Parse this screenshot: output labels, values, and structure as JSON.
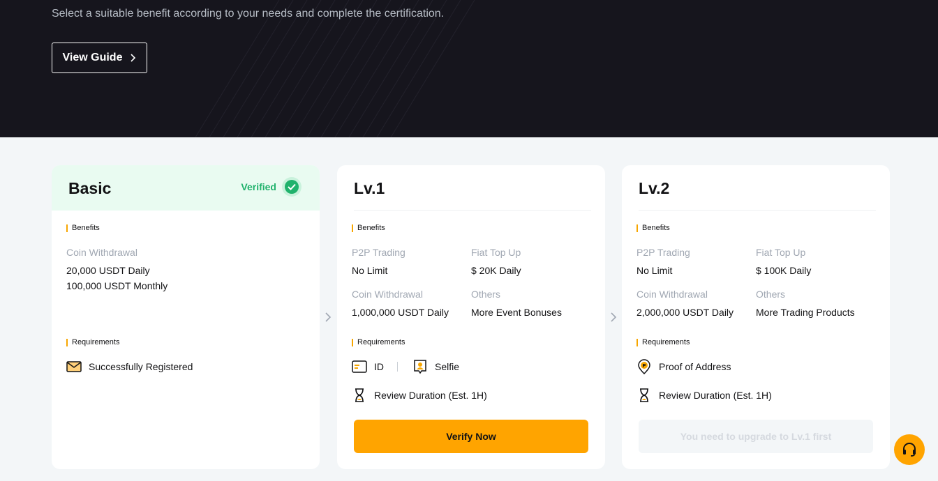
{
  "hero": {
    "subtitle": "Select a suitable benefit according to your needs and complete the certification.",
    "guide_button": "View Guide"
  },
  "labels": {
    "benefits": "Benefits",
    "requirements": "Requirements"
  },
  "basic": {
    "title": "Basic",
    "status": "Verified",
    "benefit_key": "Coin Withdrawal",
    "benefit_values": [
      "20,000 USDT Daily",
      "100,000 USDT Monthly"
    ],
    "requirement": "Successfully Registered"
  },
  "lv1": {
    "title": "Lv.1",
    "benefits": [
      {
        "key": "P2P Trading",
        "value": "No Limit"
      },
      {
        "key": "Fiat Top Up",
        "value": "$ 20K Daily"
      },
      {
        "key": "Coin Withdrawal",
        "value": "1,000,000 USDT Daily"
      },
      {
        "key": "Others",
        "value": "More Event Bonuses"
      }
    ],
    "requirements": [
      "ID",
      "Selfie"
    ],
    "review": "Review Duration (Est. 1H)",
    "button": "Verify Now"
  },
  "lv2": {
    "title": "Lv.2",
    "benefits": [
      {
        "key": "P2P Trading",
        "value": "No Limit"
      },
      {
        "key": "Fiat Top Up",
        "value": "$ 100K Daily"
      },
      {
        "key": "Coin Withdrawal",
        "value": "2,000,000 USDT Daily"
      },
      {
        "key": "Others",
        "value": "More Trading Products"
      }
    ],
    "requirements": [
      "Proof of Address"
    ],
    "review": "Review Duration (Est. 1H)",
    "button": "You need to upgrade to Lv.1 first"
  },
  "colors": {
    "accent": "#ffa400",
    "verified": "#20b26c",
    "hero_bg": "#16151d",
    "page_bg": "#f3f6f8"
  },
  "icons": {
    "guide_chevron": "chevron-right-icon",
    "verified": "check-circle-icon",
    "card_arrow": "chevron-right-icon",
    "registered": "mail-icon",
    "id": "id-card-icon",
    "selfie": "selfie-icon",
    "address": "location-pin-icon",
    "review": "hourglass-icon",
    "support": "headset-icon"
  }
}
